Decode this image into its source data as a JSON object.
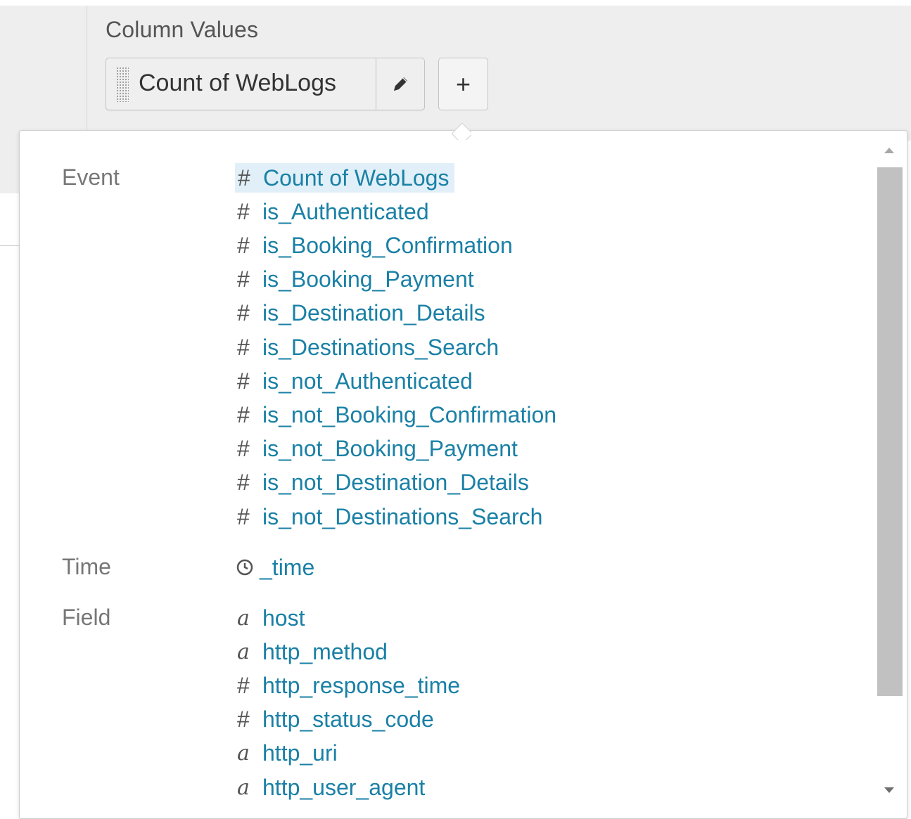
{
  "column_values": {
    "label": "Column Values",
    "selected_pill": "Count of WebLogs",
    "add_label": "+"
  },
  "dropdown": {
    "groups": [
      {
        "label": "Event",
        "items": [
          {
            "icon": "number-icon",
            "glyph": "#",
            "label": "Count of WebLogs",
            "selected": true
          },
          {
            "icon": "number-icon",
            "glyph": "#",
            "label": "is_Authenticated"
          },
          {
            "icon": "number-icon",
            "glyph": "#",
            "label": "is_Booking_Confirmation"
          },
          {
            "icon": "number-icon",
            "glyph": "#",
            "label": "is_Booking_Payment"
          },
          {
            "icon": "number-icon",
            "glyph": "#",
            "label": "is_Destination_Details"
          },
          {
            "icon": "number-icon",
            "glyph": "#",
            "label": "is_Destinations_Search"
          },
          {
            "icon": "number-icon",
            "glyph": "#",
            "label": "is_not_Authenticated"
          },
          {
            "icon": "number-icon",
            "glyph": "#",
            "label": "is_not_Booking_Confirmation"
          },
          {
            "icon": "number-icon",
            "glyph": "#",
            "label": "is_not_Booking_Payment"
          },
          {
            "icon": "number-icon",
            "glyph": "#",
            "label": "is_not_Destination_Details"
          },
          {
            "icon": "number-icon",
            "glyph": "#",
            "label": "is_not_Destinations_Search"
          }
        ]
      },
      {
        "label": "Time",
        "items": [
          {
            "icon": "clock-icon",
            "glyph": "",
            "label": "_time"
          }
        ]
      },
      {
        "label": "Field",
        "items": [
          {
            "icon": "string-icon",
            "glyph": "a",
            "label": "host"
          },
          {
            "icon": "string-icon",
            "glyph": "a",
            "label": "http_method"
          },
          {
            "icon": "number-icon",
            "glyph": "#",
            "label": "http_response_time"
          },
          {
            "icon": "number-icon",
            "glyph": "#",
            "label": "http_status_code"
          },
          {
            "icon": "string-icon",
            "glyph": "a",
            "label": "http_uri"
          },
          {
            "icon": "string-icon",
            "glyph": "a",
            "label": "http_user_agent"
          }
        ]
      }
    ]
  },
  "colors": {
    "link": "#1a80a6",
    "selected_bg": "#e1f0f8",
    "group_label": "#777777"
  }
}
